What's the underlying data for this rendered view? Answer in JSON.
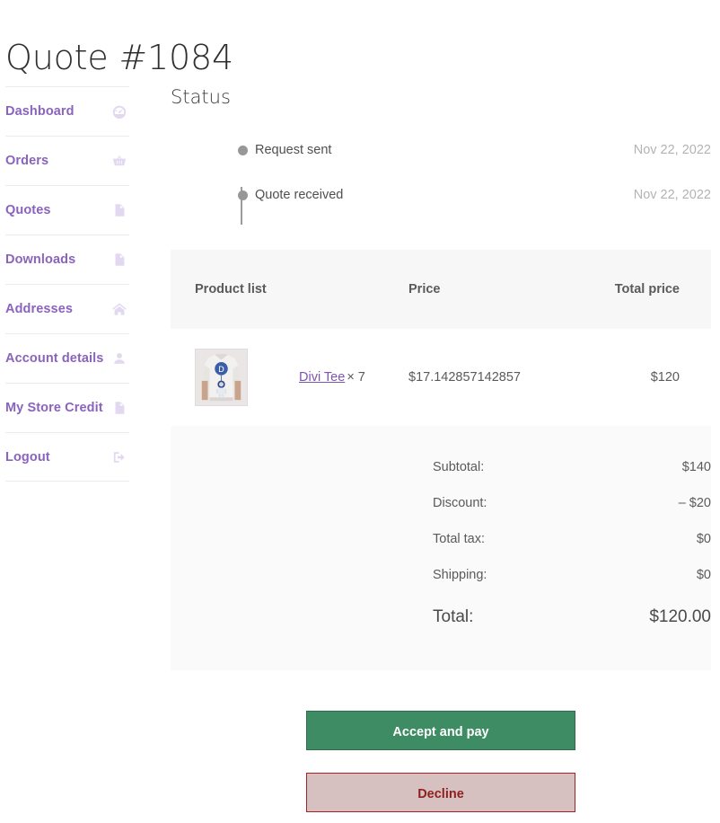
{
  "page_title": "Quote #1084",
  "sidebar": {
    "items": [
      {
        "label": "Dashboard",
        "icon": "dashboard-gauge-icon"
      },
      {
        "label": "Orders",
        "icon": "shopping-basket-icon"
      },
      {
        "label": "Quotes",
        "icon": "document-icon"
      },
      {
        "label": "Downloads",
        "icon": "file-download-icon"
      },
      {
        "label": "Addresses",
        "icon": "home-icon"
      },
      {
        "label": "Account details",
        "icon": "user-icon"
      },
      {
        "label": "My Store Credit",
        "icon": "document-icon"
      },
      {
        "label": "Logout",
        "icon": "sign-out-icon"
      }
    ]
  },
  "status": {
    "heading": "Status",
    "events": [
      {
        "label": "Request sent",
        "date": "Nov 22, 2022"
      },
      {
        "label": "Quote received",
        "date": "Nov 22, 2022"
      }
    ]
  },
  "quote_table": {
    "headers": {
      "product": "Product list",
      "price": "Price",
      "total": "Total price"
    },
    "rows": [
      {
        "name": "Divi Tee",
        "qty": "× 7",
        "price": "$17.142857142857",
        "total": "$120",
        "thumb_alt": "divi-tee-thumbnail"
      }
    ]
  },
  "totals": [
    {
      "label": "Subtotal:",
      "value": "$140"
    },
    {
      "label": "Discount:",
      "value": "– $20"
    },
    {
      "label": "Total tax:",
      "value": "$0"
    },
    {
      "label": "Shipping:",
      "value": "$0"
    }
  ],
  "grand_total": {
    "label": "Total:",
    "value": "$120.00"
  },
  "actions": {
    "accept_label": "Accept and pay",
    "decline_label": "Decline"
  },
  "colors": {
    "accent_purple": "#8a63bd",
    "link_purple": "#7d55b0",
    "accept_green": "#3e8c63",
    "decline_pink": "#d6c0c0",
    "decline_text": "#8e1f1f",
    "decline_border": "#a02423",
    "table_header_bg": "#f7f7f7",
    "totals_bg": "#fafafa",
    "timeline_dot": "#979797",
    "muted_text": "#b3b3b3"
  }
}
